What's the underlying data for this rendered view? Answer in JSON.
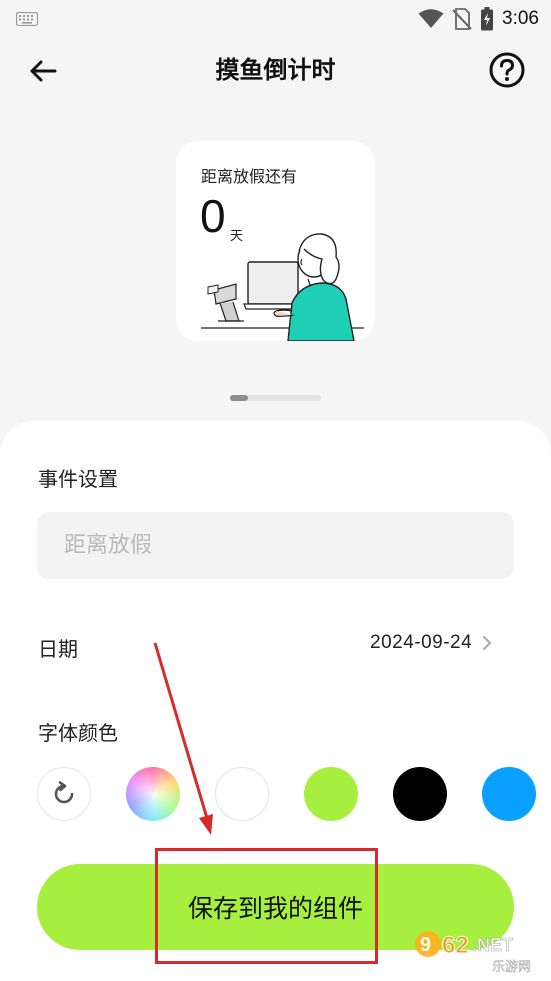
{
  "status_bar": {
    "time": "3:06",
    "icons": [
      "keyboard-icon",
      "wifi-icon",
      "no-sim-icon",
      "battery-charging-icon"
    ]
  },
  "header": {
    "title": "摸鱼倒计时",
    "back_icon": "arrow-left-icon",
    "help_icon": "question-circle-icon"
  },
  "preview": {
    "label": "距离放假还有",
    "count": "0",
    "unit": "天",
    "illustration": "person-at-laptop-illustration",
    "accent_color": "#1fcfb5"
  },
  "pager": {
    "total_pages": 2,
    "active_index": 0
  },
  "form": {
    "event_section_label": "事件设置",
    "event_placeholder": "距离放假",
    "event_value": "",
    "date_label": "日期",
    "date_value": "2024-09-24",
    "font_color_label": "字体颜色",
    "color_options": [
      {
        "name": "reset",
        "icon": "reset-icon"
      },
      {
        "name": "rainbow",
        "icon": "color-wheel"
      },
      {
        "name": "white",
        "color": "#ffffff"
      },
      {
        "name": "lime",
        "color": "#a7ef3e"
      },
      {
        "name": "black",
        "color": "#000000"
      },
      {
        "name": "blue",
        "color": "#0aa0ff"
      }
    ],
    "save_label": "保存到我的组件",
    "save_color": "#a7ef3e"
  },
  "watermark": {
    "line1": "962.NET",
    "line2": "乐游网"
  }
}
